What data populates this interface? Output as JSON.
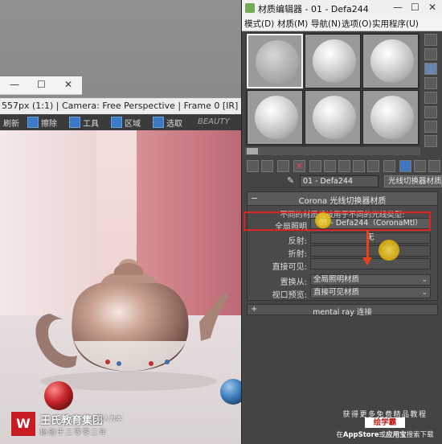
{
  "vfb": {
    "info": "557px (1:1) | Camera: Free Perspective | Frame 0 [IR]",
    "toolbar": {
      "refresh": "刷新",
      "erase": "擦除",
      "tools": "工具",
      "region": "区域",
      "select": "选取",
      "beauty": "BEAUTY"
    }
  },
  "material_editor": {
    "title": "材质编辑器 - 01 - Defa244",
    "menu": [
      "模式(D)",
      "材质(M)",
      "导航(N)",
      "选项(O)",
      "实用程序(U)"
    ],
    "material_name": "01 - Defa244",
    "material_type": "光线切换器材质",
    "rollout": {
      "title": "Corona 光线切换器材质",
      "description": "不同的材质将被用于不同的光线类型:",
      "params": [
        {
          "label": "全局照明",
          "value": "01 - Defa244（CoronaMtl）"
        },
        {
          "label": "反射:",
          "value": "无"
        },
        {
          "label": "折射:",
          "value": ""
        },
        {
          "label": "直接可见:",
          "value": ""
        }
      ],
      "dropdowns": [
        {
          "label": "置换从:",
          "value": "全局照明材质"
        },
        {
          "label": "视口预览:",
          "value": "直接可见材质"
        }
      ]
    },
    "mentalray_rollout": "mental ray 连接"
  },
  "watermark": {
    "logo": "W",
    "brand": "王氏教育集团",
    "slogan": "以人为本",
    "sub": "始创于二零零二年",
    "right_line1": "获得更多免费精品教程",
    "right_badge": "绘学霸",
    "right_line3_pre": "在",
    "right_line3_store": "AppStore",
    "right_line3_or": "或",
    "right_line3_app": "应用宝",
    "right_line3_post": "搜索下载"
  },
  "colors": {
    "highlight": "#e0231e",
    "arrow": "#e6421e",
    "cursor": "#ffd21e"
  }
}
